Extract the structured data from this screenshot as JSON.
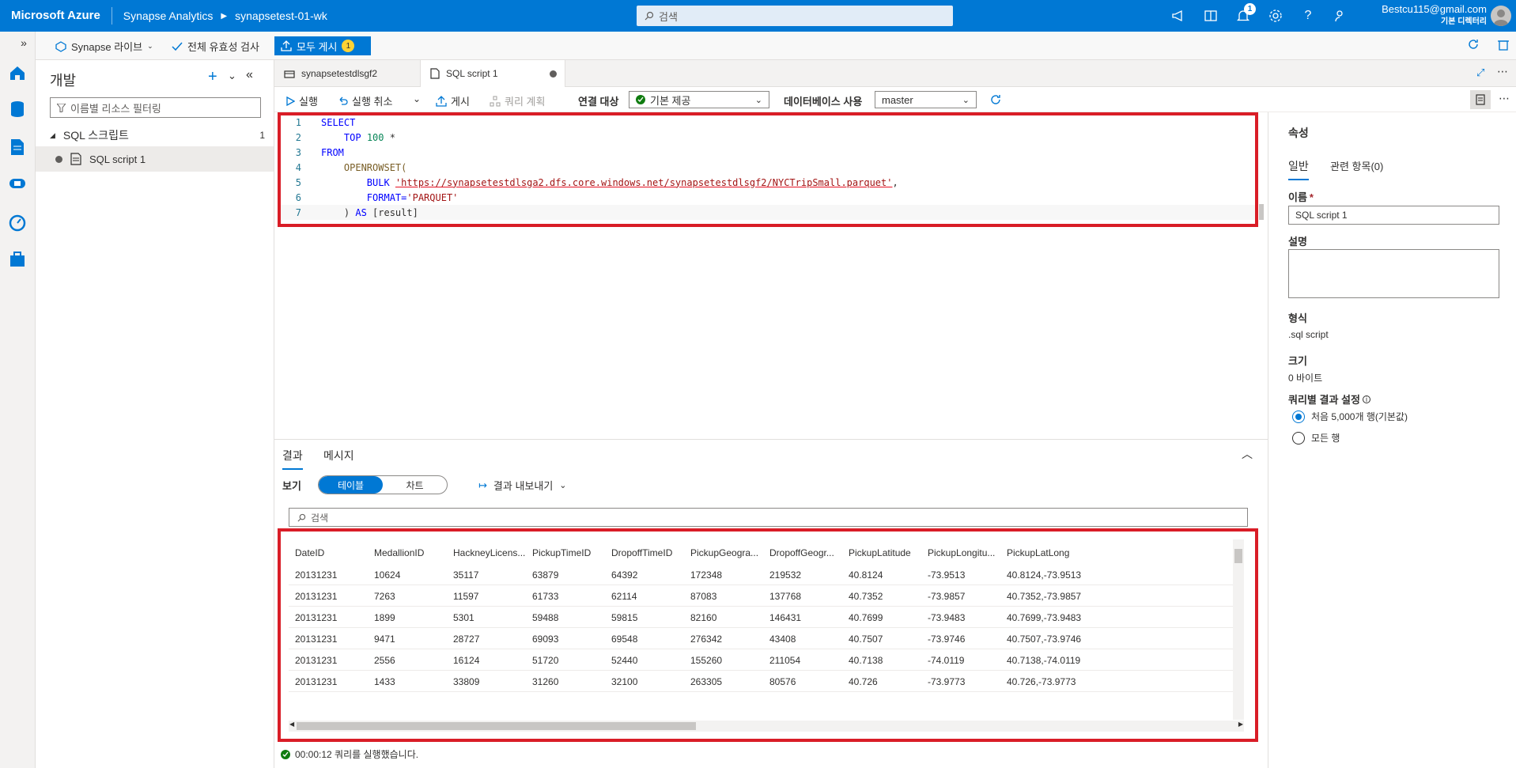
{
  "topbar": {
    "brand": "Microsoft Azure",
    "service": "Synapse Analytics",
    "workspace": "synapsetest-01-wk",
    "search_placeholder": "검색",
    "notification_count": "1",
    "account_email": "Bestcu115@gmail.com",
    "account_tenant": "기본 디렉터리"
  },
  "toolbar2": {
    "expand_label": "»",
    "synapse_live": "Synapse 라이브",
    "validate_all": "전체 유효성 검사",
    "publish_all": "모두 게시",
    "publish_count": "1"
  },
  "develop": {
    "title": "개발",
    "filter_placeholder": "이름별 리소스 필터링",
    "group_label": "SQL 스크립트",
    "group_count": "1",
    "item_label": "SQL script 1"
  },
  "tabs": [
    {
      "label": "synapsetestdlsgf2"
    },
    {
      "label": "SQL script 1"
    }
  ],
  "cmdbar": {
    "run": "실행",
    "undo": "실행 취소",
    "publish": "게시",
    "query_plan": "쿼리 계획",
    "connect_to_label": "연결 대상",
    "connect_to_value": "기본 제공",
    "use_database_label": "데이터베이스 사용",
    "use_database_value": "master"
  },
  "editor": {
    "lines": [
      {
        "n": "1",
        "t": "SELECT"
      },
      {
        "n": "2",
        "t": "TOP 100 *"
      },
      {
        "n": "3",
        "t": "FROM"
      },
      {
        "n": "4",
        "t": "OPENROWSET("
      },
      {
        "n": "5",
        "t": "BULK 'https://synapsetestdlsga2.dfs.core.windows.net/synapsetestdlsgf2/NYCTripSmall.parquet',"
      },
      {
        "n": "6",
        "t": "FORMAT='PARQUET'"
      },
      {
        "n": "7",
        "t": ") AS [result]"
      }
    ],
    "kw_select": "SELECT",
    "kw_top": "TOP",
    "num_100": "100",
    "star": " *",
    "kw_from": "FROM",
    "fn_openrowset": "OPENROWSET(",
    "kw_bulk": "BULK ",
    "url": "'https://synapsetestdlsga2.dfs.core.windows.net/synapsetestdlsgf2/NYCTripSmall.parquet'",
    "comma": ",",
    "kw_format": "FORMAT=",
    "str_parquet": "'PARQUET'",
    "close_paren": ") ",
    "kw_as": "AS",
    "alias": " [result]"
  },
  "properties": {
    "title": "속성",
    "tab_general": "일반",
    "tab_related": "관련 항목(0)",
    "name_label": "이름",
    "name_required": "*",
    "name_value": "SQL script 1",
    "description_label": "설명",
    "type_label": "형식",
    "type_value": ".sql script",
    "size_label": "크기",
    "size_value": "0 바이트",
    "result_setting_label": "쿼리별 결과 설정",
    "option_first": "처음 5,000개 행(기본값)",
    "option_all": "모든 행"
  },
  "results": {
    "tab_results": "결과",
    "tab_messages": "메시지",
    "view_label": "보기",
    "view_table": "테이블",
    "view_chart": "차트",
    "export": "결과 내보내기",
    "search_placeholder": "검색",
    "columns": [
      "DateID",
      "MedallionID",
      "HackneyLicens...",
      "PickupTimeID",
      "DropoffTimeID",
      "PickupGeogra...",
      "DropoffGeogr...",
      "PickupLatitude",
      "PickupLongitu...",
      "PickupLatLong"
    ],
    "rows": [
      [
        "20131231",
        "10624",
        "35117",
        "63879",
        "64392",
        "172348",
        "219532",
        "40.8124",
        "-73.9513",
        "40.8124,-73.9513"
      ],
      [
        "20131231",
        "7263",
        "11597",
        "61733",
        "62114",
        "87083",
        "137768",
        "40.7352",
        "-73.9857",
        "40.7352,-73.9857"
      ],
      [
        "20131231",
        "1899",
        "5301",
        "59488",
        "59815",
        "82160",
        "146431",
        "40.7699",
        "-73.9483",
        "40.7699,-73.9483"
      ],
      [
        "20131231",
        "9471",
        "28727",
        "69093",
        "69548",
        "276342",
        "43408",
        "40.7507",
        "-73.9746",
        "40.7507,-73.9746"
      ],
      [
        "20131231",
        "2556",
        "16124",
        "51720",
        "52440",
        "155260",
        "211054",
        "40.7138",
        "-74.0119",
        "40.7138,-74.0119"
      ],
      [
        "20131231",
        "1433",
        "33809",
        "31260",
        "32100",
        "263305",
        "80576",
        "40.726",
        "-73.9773",
        "40.726,-73.9773"
      ]
    ],
    "status": "00:00:12 쿼리를 실행했습니다."
  }
}
